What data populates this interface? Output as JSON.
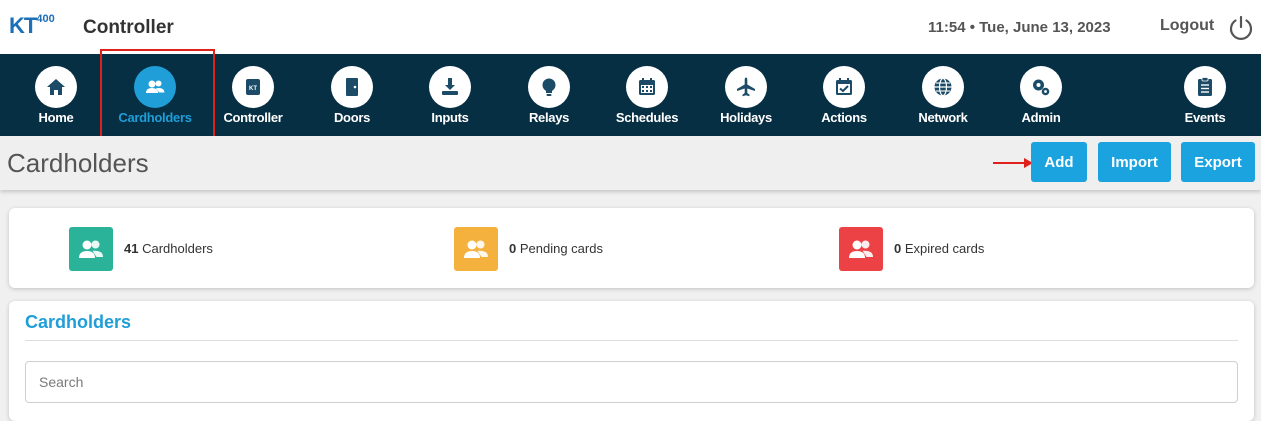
{
  "header": {
    "logo_text": "KT",
    "logo_sup": "400",
    "app_title": "Controller",
    "datetime": "11:54 • Tue, June 13, 2023",
    "logout_label": "Logout",
    "power_icon": "power-icon"
  },
  "nav": {
    "items": [
      {
        "label": "Home",
        "icon": "home-icon"
      },
      {
        "label": "Cardholders",
        "icon": "cardholders-icon",
        "active": true
      },
      {
        "label": "Controller",
        "icon": "controller-icon"
      },
      {
        "label": "Doors",
        "icon": "door-icon"
      },
      {
        "label": "Inputs",
        "icon": "input-icon"
      },
      {
        "label": "Relays",
        "icon": "lightbulb-icon"
      },
      {
        "label": "Schedules",
        "icon": "calendar-icon"
      },
      {
        "label": "Holidays",
        "icon": "airplane-icon"
      },
      {
        "label": "Actions",
        "icon": "calendar-check-icon"
      },
      {
        "label": "Network",
        "icon": "globe-icon"
      },
      {
        "label": "Admin",
        "icon": "gears-icon"
      },
      {
        "label": "Events",
        "icon": "clipboard-icon"
      }
    ]
  },
  "page": {
    "title": "Cardholders",
    "buttons": {
      "add": "Add",
      "import": "Import",
      "export": "Export"
    }
  },
  "stats": [
    {
      "count": "41",
      "label": "Cardholders",
      "color": "#2bb39a"
    },
    {
      "count": "0",
      "label": "Pending cards",
      "color": "#f4b13e"
    },
    {
      "count": "0",
      "label": "Expired cards",
      "color": "#ec4145"
    }
  ],
  "list": {
    "title": "Cardholders",
    "search_placeholder": "Search"
  },
  "colors": {
    "navbar": "#072f44",
    "accent": "#1f9ed8",
    "button": "#1ba3e0",
    "highlight": "#e0201b"
  }
}
